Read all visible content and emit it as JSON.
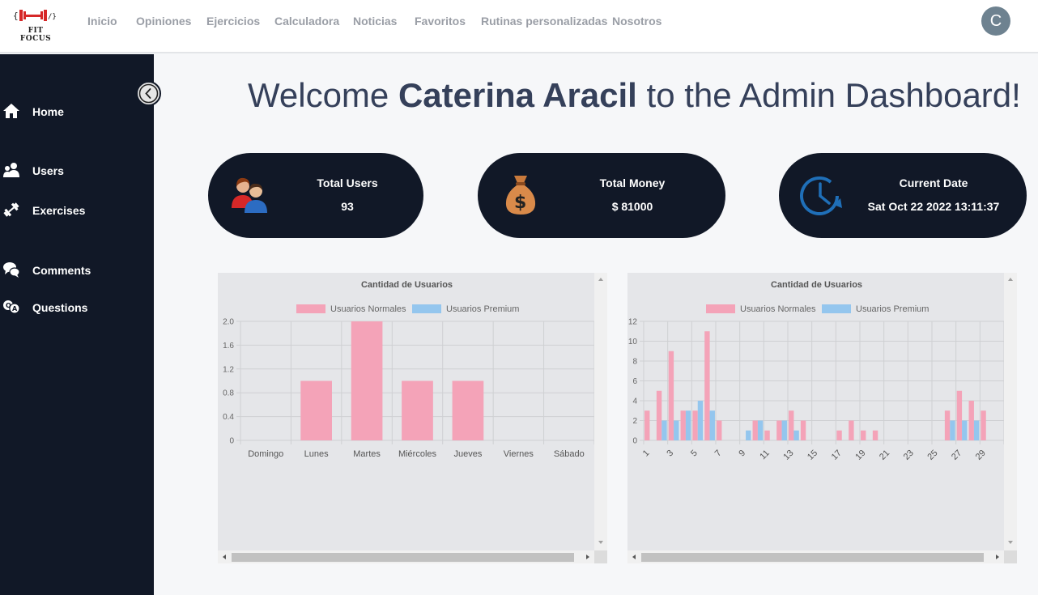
{
  "brand": {
    "name": "FIT FOCUS"
  },
  "nav": {
    "items": [
      "Inicio",
      "Opiniones",
      "Ejercicios",
      "Calculadora",
      "Noticias",
      "Favoritos",
      "Rutinas personalizadas",
      "Nosotros"
    ],
    "avatar_letter": "C"
  },
  "sidebar": {
    "items": [
      {
        "label": "Home",
        "icon": "home-icon"
      },
      {
        "label": "Users",
        "icon": "users-icon"
      },
      {
        "label": "Exercises",
        "icon": "dumbbell-icon"
      },
      {
        "label": "Comments",
        "icon": "comments-icon"
      },
      {
        "label": "Questions",
        "icon": "questions-icon"
      }
    ],
    "collapse_icon": "chevron-left-icon"
  },
  "welcome": {
    "prefix": "Welcome ",
    "name": "Caterina Aracil",
    "suffix": " to the Admin Dashboard!"
  },
  "cards": [
    {
      "title": "Total Users",
      "value": "93",
      "icon": "users-group-icon"
    },
    {
      "title": "Total Money",
      "value": "$ 81000",
      "icon": "money-bag-icon"
    },
    {
      "title": "Current Date",
      "value": "Sat Oct 22 2022 13:11:37",
      "icon": "clock-icon"
    }
  ],
  "colors": {
    "normal": "#f4a3b8",
    "premium": "#94c6ee",
    "dark": "#111827",
    "accent": "#1f6fb8"
  },
  "chart_data": [
    {
      "type": "bar",
      "title": "Cantidad de Usuarios",
      "categories": [
        "Domingo",
        "Lunes",
        "Martes",
        "Miércoles",
        "Jueves",
        "Viernes",
        "Sábado"
      ],
      "series": [
        {
          "name": "Usuarios Normales",
          "values": [
            0,
            1,
            2,
            1,
            1,
            0,
            0
          ]
        },
        {
          "name": "Usuarios Premium",
          "values": [
            0,
            0,
            0,
            0,
            0,
            0,
            0
          ]
        }
      ],
      "ylim": [
        0,
        2.0
      ],
      "yticks": [
        "2.0",
        "1.6",
        "1.2",
        "0.8",
        "0.4",
        "0"
      ],
      "legend": "top",
      "grid": true
    },
    {
      "type": "bar",
      "title": "Cantidad de Usuarios",
      "categories": [
        "1",
        "2",
        "3",
        "4",
        "5",
        "6",
        "7",
        "8",
        "9",
        "10",
        "11",
        "12",
        "13",
        "14",
        "15",
        "16",
        "17",
        "18",
        "19",
        "20",
        "21",
        "22",
        "23",
        "24",
        "25",
        "26",
        "27",
        "28",
        "29",
        "30"
      ],
      "xtick_labels": [
        "1",
        "3",
        "5",
        "7",
        "9",
        "11",
        "13",
        "15",
        "17",
        "19",
        "21",
        "23",
        "25",
        "27",
        "29"
      ],
      "series": [
        {
          "name": "Usuarios Normales",
          "values": [
            3,
            5,
            9,
            3,
            3,
            11,
            2,
            0,
            0,
            2,
            1,
            2,
            3,
            2,
            0,
            0,
            1,
            2,
            1,
            1,
            0,
            0,
            0,
            0,
            0,
            3,
            5,
            4,
            3,
            0
          ]
        },
        {
          "name": "Usuarios Premium",
          "values": [
            0,
            2,
            2,
            3,
            4,
            3,
            0,
            0,
            1,
            2,
            0,
            2,
            1,
            0,
            0,
            0,
            0,
            0,
            0,
            0,
            0,
            0,
            0,
            0,
            0,
            2,
            2,
            2,
            0,
            0
          ]
        }
      ],
      "ylim": [
        0,
        12
      ],
      "yticks": [
        "12",
        "10",
        "8",
        "6",
        "4",
        "2",
        "0"
      ],
      "legend": "top",
      "grid": true
    }
  ]
}
